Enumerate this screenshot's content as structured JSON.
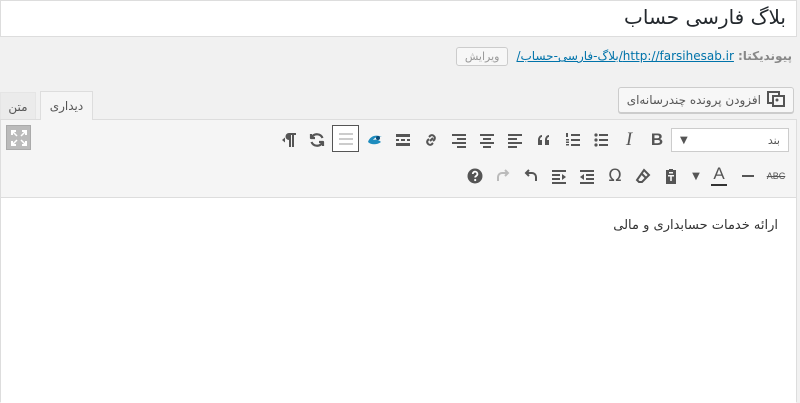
{
  "title": "بلاگ فارسی حساب",
  "permalink": {
    "label": "پیوندیکتا:",
    "url": "http://farsihesab.ir/بلاگ-فارسی-حساب/",
    "edit_label": "ویرایش"
  },
  "media_button": {
    "label": "افزودن پرونده چندرسانه‌ای"
  },
  "tabs": {
    "visual": "دیداری",
    "text": "متن"
  },
  "toolbar": {
    "format_select": {
      "value": "بند"
    },
    "bold_glyph": "B",
    "italic_glyph": "I",
    "textcolor_glyph": "A",
    "strike_glyph": "ABC"
  },
  "content": {
    "text": "ارائه خدمات حسابداری و مالی"
  }
}
